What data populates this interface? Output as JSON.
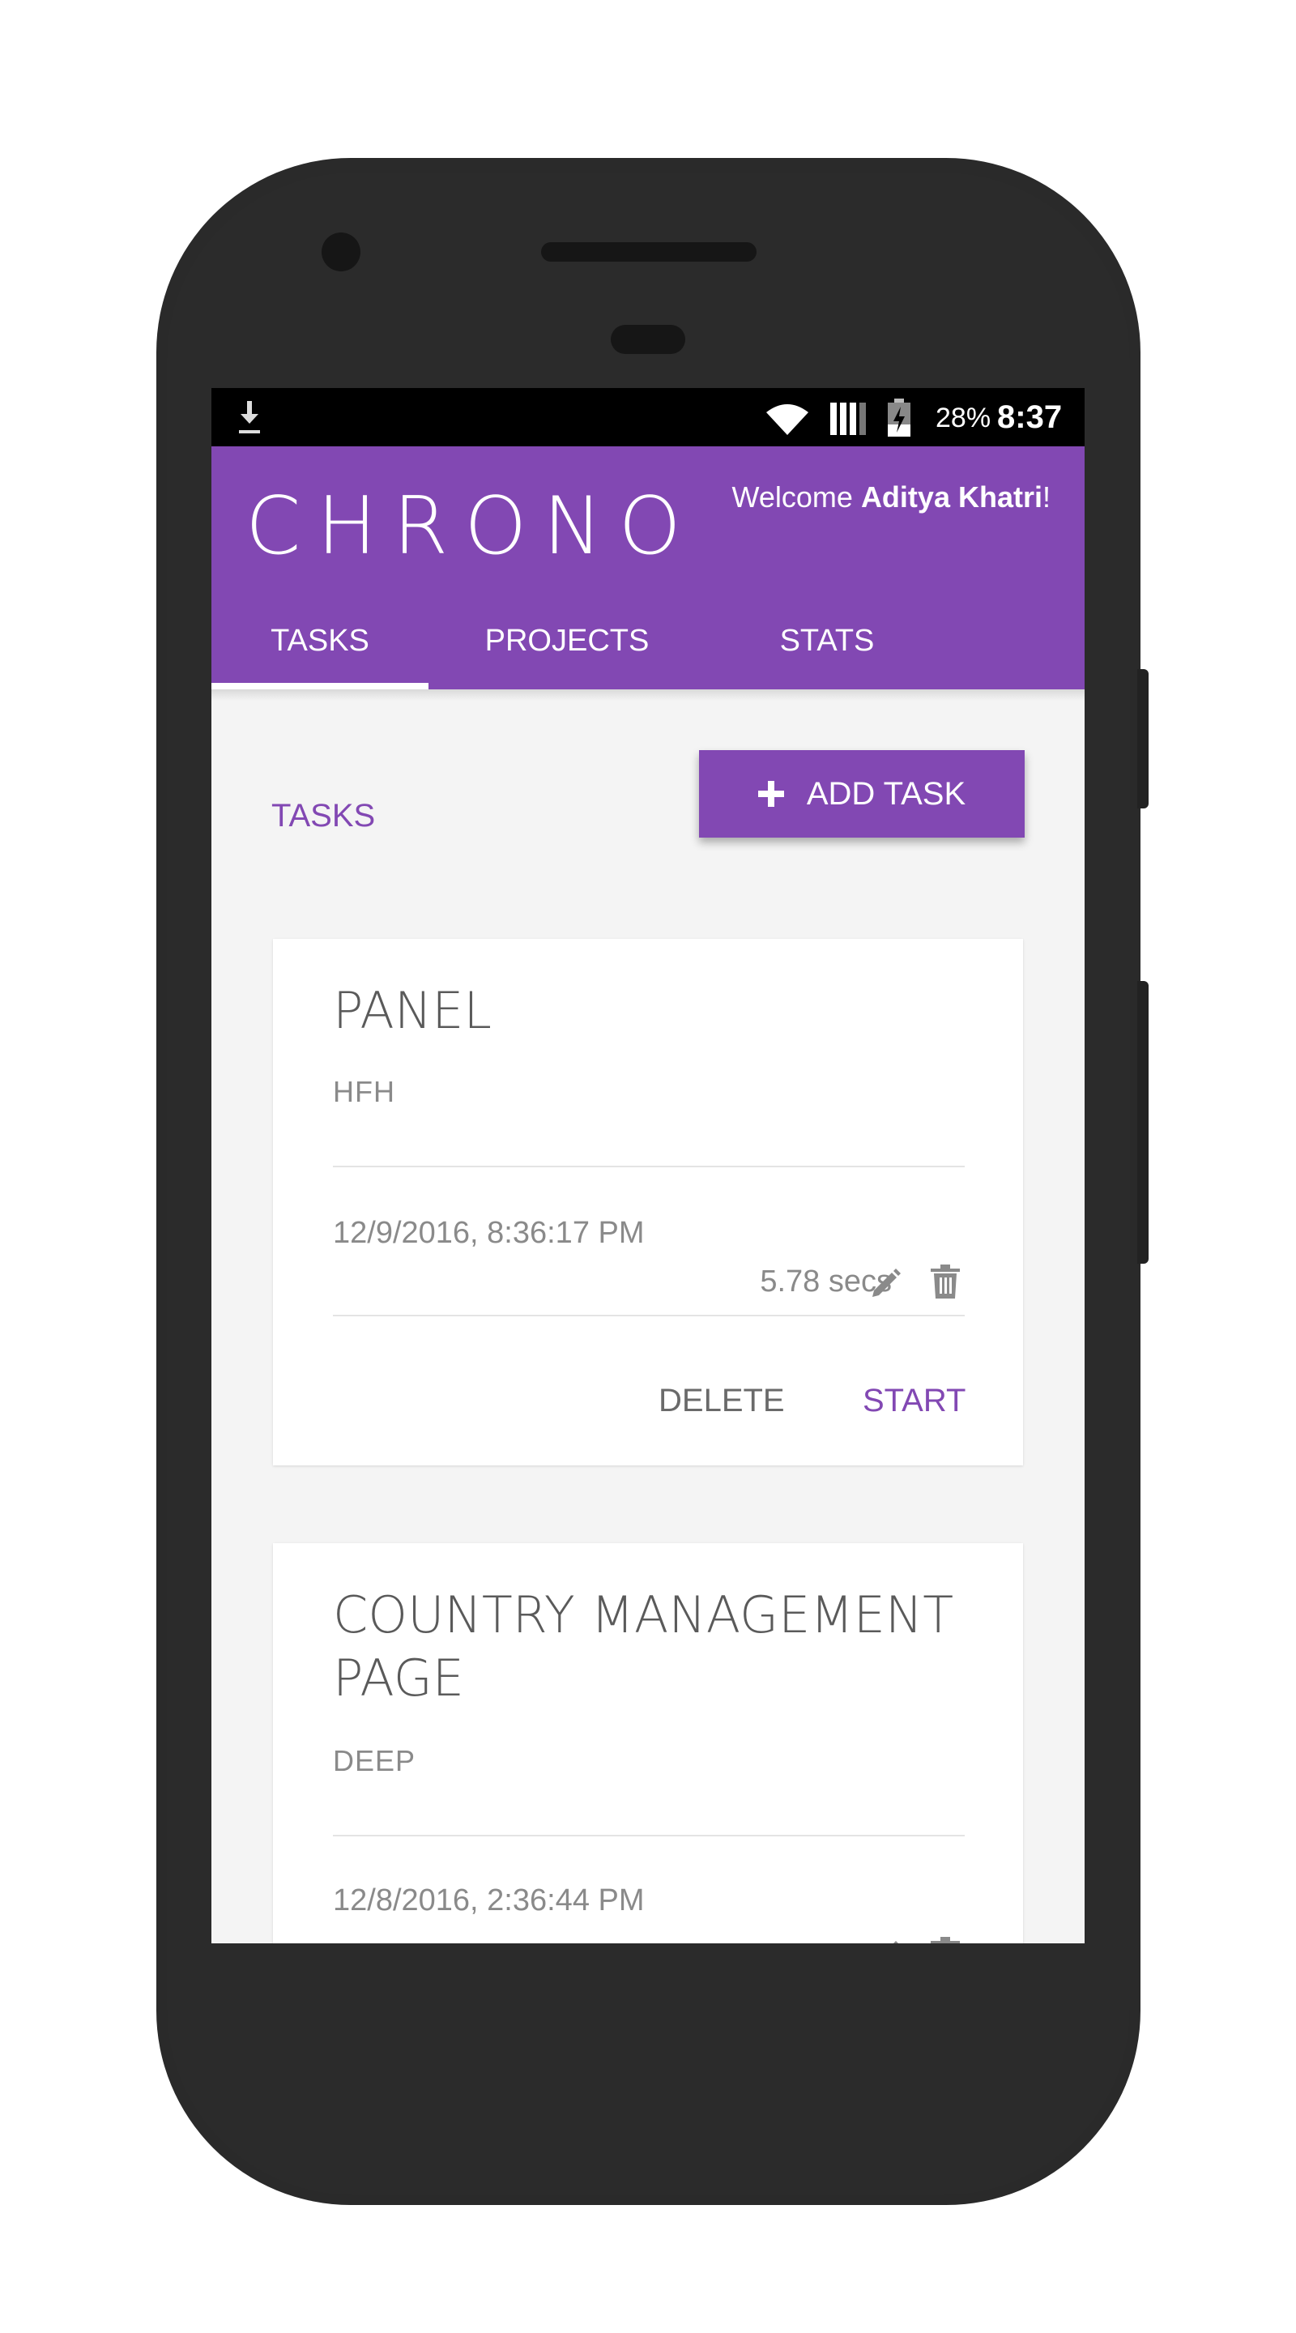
{
  "status_bar": {
    "battery_percent": "28%",
    "time": "8:37",
    "icons": [
      "download-icon",
      "wifi-icon",
      "signal-icon",
      "battery-charging-icon"
    ]
  },
  "header": {
    "app_name": "CHRONO",
    "welcome_prefix": "Welcome ",
    "user_name": "Aditya Khatri",
    "welcome_suffix": "!",
    "tabs": [
      {
        "label": "TASKS",
        "active": true
      },
      {
        "label": "PROJECTS",
        "active": false
      },
      {
        "label": "STATS",
        "active": false
      }
    ]
  },
  "main": {
    "section_title": "TASKS",
    "add_button_label": "ADD TASK",
    "tasks": [
      {
        "title": "PANEL",
        "project": "HFH",
        "date": "12/9/2016, 8:36:17 PM",
        "duration": "5.78 secs",
        "delete_label": "DELETE",
        "start_label": "START"
      },
      {
        "title": "COUNTRY MANAGEMENT PAGE",
        "project": "DEEP",
        "date": "12/8/2016, 2:36:44 PM"
      }
    ]
  },
  "colors": {
    "accent": "#8248b3",
    "status_bar": "#000000",
    "background": "#f4f4f4",
    "card": "#ffffff",
    "phone_body": "#2a2a2a"
  }
}
